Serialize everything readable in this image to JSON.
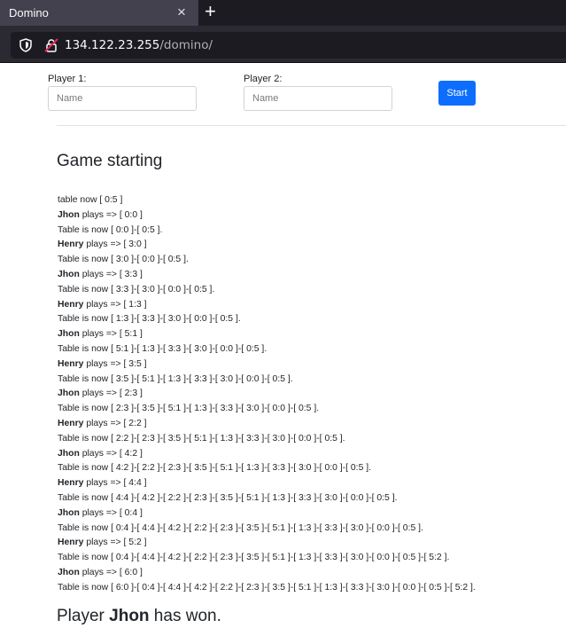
{
  "browser": {
    "tab_title": "Domino",
    "tab_close": "×",
    "new_tab": "+",
    "url_host": "134.122.23.255",
    "url_path": "/domino/"
  },
  "form": {
    "player1_label": "Player 1:",
    "player1_placeholder": "Name",
    "player2_label": "Player 2:",
    "player2_placeholder": "Name",
    "start_label": "Start"
  },
  "game": {
    "heading": "Game starting",
    "log": [
      {
        "player": "",
        "text": "table now [ 0:5 ]"
      },
      {
        "player": "Jhon",
        "text": " plays => [ 0:0 ]"
      },
      {
        "player": "",
        "text": "Table is now [ 0:0 ]-[ 0:5 ]."
      },
      {
        "player": "Henry",
        "text": " plays => [ 3:0 ]"
      },
      {
        "player": "",
        "text": "Table is now [ 3:0 ]-[ 0:0 ]-[ 0:5 ]."
      },
      {
        "player": "Jhon",
        "text": " plays => [ 3:3 ]"
      },
      {
        "player": "",
        "text": "Table is now [ 3:3 ]-[ 3:0 ]-[ 0:0 ]-[ 0:5 ]."
      },
      {
        "player": "Henry",
        "text": " plays => [ 1:3 ]"
      },
      {
        "player": "",
        "text": "Table is now [ 1:3 ]-[ 3:3 ]-[ 3:0 ]-[ 0:0 ]-[ 0:5 ]."
      },
      {
        "player": "Jhon",
        "text": " plays => [ 5:1 ]"
      },
      {
        "player": "",
        "text": "Table is now [ 5:1 ]-[ 1:3 ]-[ 3:3 ]-[ 3:0 ]-[ 0:0 ]-[ 0:5 ]."
      },
      {
        "player": "Henry",
        "text": " plays => [ 3:5 ]"
      },
      {
        "player": "",
        "text": "Table is now [ 3:5 ]-[ 5:1 ]-[ 1:3 ]-[ 3:3 ]-[ 3:0 ]-[ 0:0 ]-[ 0:5 ]."
      },
      {
        "player": "Jhon",
        "text": " plays => [ 2:3 ]"
      },
      {
        "player": "",
        "text": "Table is now [ 2:3 ]-[ 3:5 ]-[ 5:1 ]-[ 1:3 ]-[ 3:3 ]-[ 3:0 ]-[ 0:0 ]-[ 0:5 ]."
      },
      {
        "player": "Henry",
        "text": " plays => [ 2:2 ]"
      },
      {
        "player": "",
        "text": "Table is now [ 2:2 ]-[ 2:3 ]-[ 3:5 ]-[ 5:1 ]-[ 1:3 ]-[ 3:3 ]-[ 3:0 ]-[ 0:0 ]-[ 0:5 ]."
      },
      {
        "player": "Jhon",
        "text": " plays => [ 4:2 ]"
      },
      {
        "player": "",
        "text": "Table is now [ 4:2 ]-[ 2:2 ]-[ 2:3 ]-[ 3:5 ]-[ 5:1 ]-[ 1:3 ]-[ 3:3 ]-[ 3:0 ]-[ 0:0 ]-[ 0:5 ]."
      },
      {
        "player": "Henry",
        "text": " plays => [ 4:4 ]"
      },
      {
        "player": "",
        "text": "Table is now [ 4:4 ]-[ 4:2 ]-[ 2:2 ]-[ 2:3 ]-[ 3:5 ]-[ 5:1 ]-[ 1:3 ]-[ 3:3 ]-[ 3:0 ]-[ 0:0 ]-[ 0:5 ]."
      },
      {
        "player": "Jhon",
        "text": " plays => [ 0:4 ]"
      },
      {
        "player": "",
        "text": "Table is now [ 0:4 ]-[ 4:4 ]-[ 4:2 ]-[ 2:2 ]-[ 2:3 ]-[ 3:5 ]-[ 5:1 ]-[ 1:3 ]-[ 3:3 ]-[ 3:0 ]-[ 0:0 ]-[ 0:5 ]."
      },
      {
        "player": "Henry",
        "text": " plays => [ 5:2 ]"
      },
      {
        "player": "",
        "text": "Table is now [ 0:4 ]-[ 4:4 ]-[ 4:2 ]-[ 2:2 ]-[ 2:3 ]-[ 3:5 ]-[ 5:1 ]-[ 1:3 ]-[ 3:3 ]-[ 3:0 ]-[ 0:0 ]-[ 0:5 ]-[ 5:2 ]."
      },
      {
        "player": "Jhon",
        "text": " plays => [ 6:0 ]"
      },
      {
        "player": "",
        "text": "Table is now [ 6:0 ]-[ 0:4 ]-[ 4:4 ]-[ 4:2 ]-[ 2:2 ]-[ 2:3 ]-[ 3:5 ]-[ 5:1 ]-[ 1:3 ]-[ 3:3 ]-[ 3:0 ]-[ 0:0 ]-[ 0:5 ]-[ 5:2 ]."
      }
    ],
    "result_prefix": "Player ",
    "result_winner": "Jhon",
    "result_suffix": " has won."
  }
}
